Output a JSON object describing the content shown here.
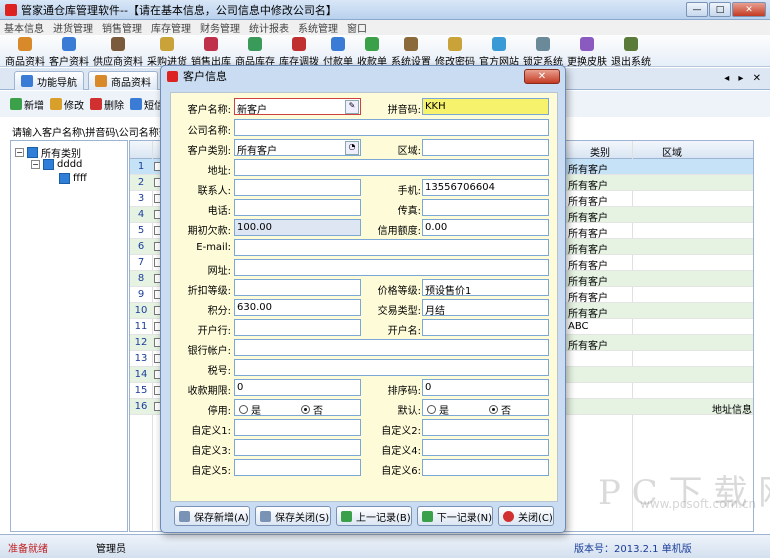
{
  "window": {
    "title": "管家通仓库管理软件--【请在基本信息，公司信息中修改公司名】",
    "min": "—",
    "max": "□",
    "close": "✕"
  },
  "menu": [
    "基本信息",
    "进货管理",
    "销售管理",
    "库存管理",
    "财务管理",
    "统计报表",
    "系统管理",
    "窗口"
  ],
  "toolbar": [
    {
      "label": "商品资料",
      "color": "#d88a2a"
    },
    {
      "label": "客户资料",
      "color": "#3a7bd5"
    },
    {
      "label": "供应商资料",
      "color": "#7a5a3a"
    },
    {
      "label": "采购进货",
      "color": "#c9a23a"
    },
    {
      "label": "销售出库",
      "color": "#c0304a"
    },
    {
      "label": "商品库存",
      "color": "#3a9a5a"
    },
    {
      "label": "库存调拨",
      "color": "#c03030"
    },
    {
      "label": "付款单",
      "color": "#3a7bd5"
    },
    {
      "label": "收款单",
      "color": "#3aa04a"
    },
    {
      "label": "系统设置",
      "color": "#8a6a3a"
    },
    {
      "label": "修改密码",
      "color": "#c9a23a"
    },
    {
      "label": "官方网站",
      "color": "#3a9ad5"
    },
    {
      "label": "锁定系统",
      "color": "#6a8a9a"
    },
    {
      "label": "更换皮肤",
      "color": "#8a5ac0"
    },
    {
      "label": "退出系统",
      "color": "#5a7a3a"
    }
  ],
  "tabs": [
    {
      "label": "功能导航"
    },
    {
      "label": "商品资料"
    },
    {
      "label": "客户资料"
    }
  ],
  "tabnav": "◂ ▸ ✕",
  "subtool": [
    {
      "label": "新增",
      "color": "#3aa04a"
    },
    {
      "label": "修改",
      "color": "#d8a02a"
    },
    {
      "label": "删除",
      "color": "#d03030"
    },
    {
      "label": "短信",
      "color": "#3a7bd5"
    }
  ],
  "search": {
    "prompt": "请输入客户名称\\拼音码\\公司名称查询"
  },
  "tree": {
    "root": "所有类别",
    "child": "dddd",
    "leaf": "ffff",
    "minus": "−"
  },
  "grid": {
    "headers": {
      "type": "类别",
      "area": "区域"
    },
    "rows": [
      {
        "num": "1",
        "type": "所有客户",
        "extra": ""
      },
      {
        "num": "2",
        "type": "所有客户",
        "extra": ""
      },
      {
        "num": "3",
        "type": "所有客户",
        "extra": ""
      },
      {
        "num": "4",
        "type": "所有客户",
        "extra": ""
      },
      {
        "num": "5",
        "type": "所有客户",
        "extra": ""
      },
      {
        "num": "6",
        "type": "所有客户",
        "extra": ""
      },
      {
        "num": "7",
        "type": "所有客户",
        "extra": ""
      },
      {
        "num": "8",
        "type": "所有客户",
        "extra": ""
      },
      {
        "num": "9",
        "type": "所有客户",
        "extra": ""
      },
      {
        "num": "10",
        "type": "所有客户",
        "extra": ""
      },
      {
        "num": "11",
        "type": "ABC",
        "extra": ""
      },
      {
        "num": "12",
        "type": "所有客户",
        "extra": ""
      },
      {
        "num": "13",
        "type": "",
        "extra": ""
      },
      {
        "num": "14",
        "type": "",
        "extra": ""
      },
      {
        "num": "15",
        "type": "",
        "extra": ""
      },
      {
        "num": "16",
        "type": "",
        "extra": "地址信息"
      }
    ]
  },
  "status": {
    "ready": "准备就绪",
    "user": "管理员",
    "version": "版本号：2013.2.1 单机版"
  },
  "watermark": {
    "main": "P C 下 载 网",
    "url": "www.pcsoft.com.cn"
  },
  "dialog": {
    "title": "客户信息",
    "close": "✕",
    "labels": {
      "name": "客户名称:",
      "pinyin": "拼音码:",
      "company": "公司名称:",
      "ctype": "客户类别:",
      "region": "区域:",
      "address": "地址:",
      "contact": "联系人:",
      "mobile": "手机:",
      "phone": "电话:",
      "fax": "传真:",
      "initdebt": "期初欠款:",
      "credit": "信用额度:",
      "email": "E-mail:",
      "web": "网址:",
      "discount": "折扣等级:",
      "pricelevel": "价格等级:",
      "points": "积分:",
      "tradetype": "交易类型:",
      "bank": "开户行:",
      "accname": "开户名:",
      "bankacc": "银行帐户:",
      "taxno": "税号:",
      "period": "收款期限:",
      "sortno": "排序码:",
      "disabled": "停用:",
      "default": "默认:",
      "c1": "自定义1:",
      "c2": "自定义2:",
      "c3": "自定义3:",
      "c4": "自定义4:",
      "c5": "自定义5:",
      "c6": "自定义6:"
    },
    "values": {
      "name": "新客户",
      "pinyin": "KKH",
      "ctype": "所有客户",
      "mobile": "13556706604",
      "initdebt": "100.00",
      "credit": "0.00",
      "pricelevel": "预设售价1",
      "points": "630.00",
      "tradetype": "月结",
      "period": "0",
      "sortno": "0"
    },
    "radio": {
      "yes": "是",
      "no": "否"
    },
    "buttons": {
      "savenew": "保存新增(A)",
      "saveclose": "保存关闭(S)",
      "prev": "上一记录(B)",
      "next": "下一记录(N)",
      "close": "关闭(C)"
    }
  }
}
